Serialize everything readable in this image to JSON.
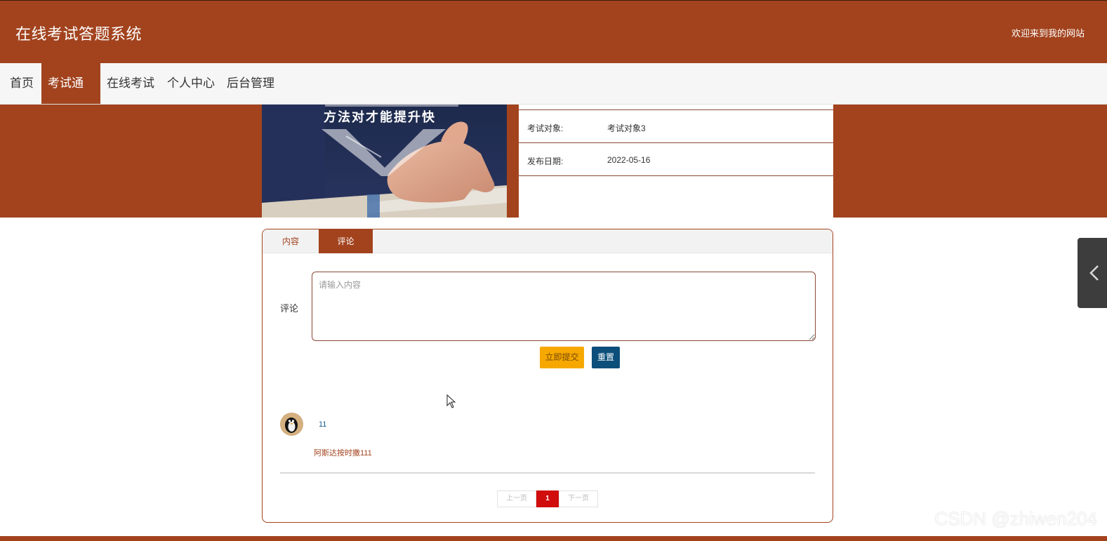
{
  "header": {
    "site_title": "在线考试答题系统",
    "welcome": "欢迎来到我的网站"
  },
  "nav": {
    "items": [
      {
        "label": "首页",
        "active": false
      },
      {
        "label": "考试通知",
        "active": true
      },
      {
        "label": "在线考试",
        "active": false
      },
      {
        "label": "个人中心",
        "active": false
      },
      {
        "label": "后台管理",
        "active": false
      }
    ]
  },
  "notice": {
    "cover_caption": "方法对才能提升快",
    "fields": [
      {
        "label": "考试对象:",
        "value": "考试对象3"
      },
      {
        "label": "发布日期:",
        "value": "2022-05-16"
      }
    ]
  },
  "tabs": {
    "content": "内容",
    "comment": "评论",
    "active": "comment"
  },
  "comment_form": {
    "label": "评论",
    "placeholder": "请输入内容",
    "value": "",
    "submit_label": "立即提交",
    "reset_label": "重置"
  },
  "comments": [
    {
      "user": "11",
      "text": "阿斯达按时撒111",
      "avatar_icon": "penguin-avatar-icon"
    }
  ],
  "pagination": {
    "prev_label": "上一页",
    "current_page": "1",
    "next_label": "下一页"
  },
  "side_toggle": {
    "icon": "chevron-left-icon"
  },
  "watermark": "CSDN @zhiwen204",
  "colors": {
    "brand": "#a2431e",
    "submit": "#f6a800",
    "reset": "#0c4f7a",
    "current_page": "#d00c0c"
  }
}
